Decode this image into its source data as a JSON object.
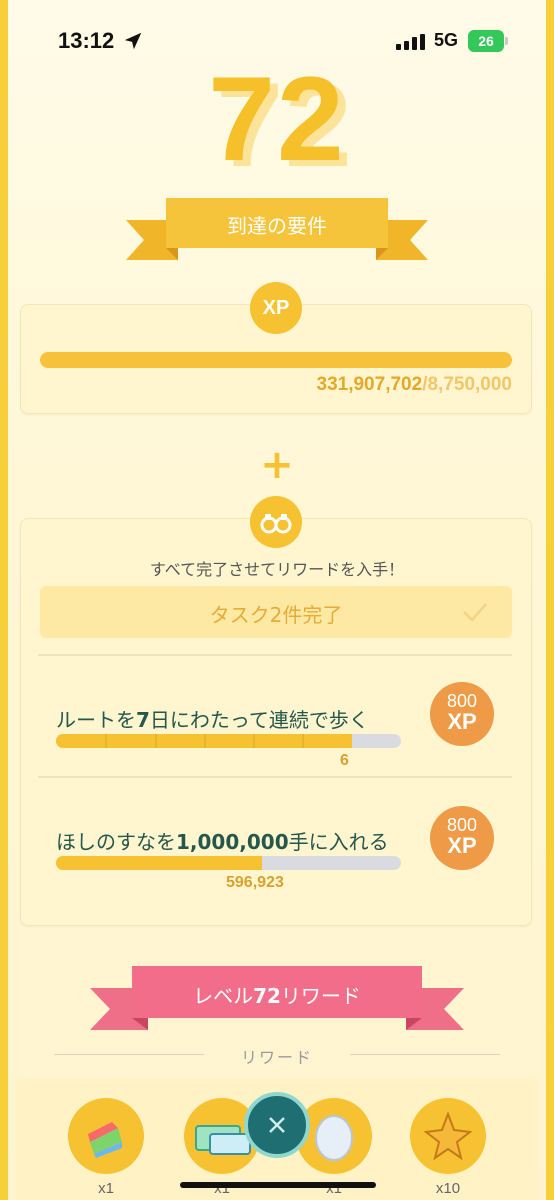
{
  "status_bar": {
    "time": "13:12",
    "network": "5G",
    "battery": "26"
  },
  "level": {
    "number": "72",
    "requirements_title": "到達の要件"
  },
  "xp_card": {
    "badge": "XP",
    "current": "331,907,702",
    "separator": "/",
    "total": "8,750,000",
    "progress_fraction": 1.0
  },
  "plus": "+",
  "tasks_card": {
    "subtitle": "すべて完了させてリワードを入手！",
    "complete_label": "タスク2件完了",
    "tasks": [
      {
        "title_pre": "ルートを",
        "title_bold": "7",
        "title_post": "日にわたって連続で歩く",
        "progress_value": "6",
        "progress_fraction": 0.857,
        "segments": 7,
        "reward_amount": "800",
        "reward_unit": "XP"
      },
      {
        "title_pre": "ほしのすなを",
        "title_bold": "1,000,000",
        "title_post": "手に入れる",
        "progress_value": "596,923",
        "progress_fraction": 0.597,
        "reward_amount": "800",
        "reward_unit": "XP"
      }
    ]
  },
  "rewards": {
    "title_pre": "レベル",
    "title_bold": "72",
    "title_post": "リワード",
    "section_label": "リワード",
    "items": [
      {
        "icon": "rainbow-candy-icon",
        "qty": "x1"
      },
      {
        "icon": "ticket-icon",
        "qty": "x1"
      },
      {
        "icon": "egg-icon",
        "qty": "x1"
      },
      {
        "icon": "star-piece-icon",
        "qty": "x10"
      }
    ]
  },
  "colors": {
    "gold": "#f7c232",
    "orange": "#ee9a46",
    "pink": "#f06b86",
    "teal": "#1f6e72"
  }
}
